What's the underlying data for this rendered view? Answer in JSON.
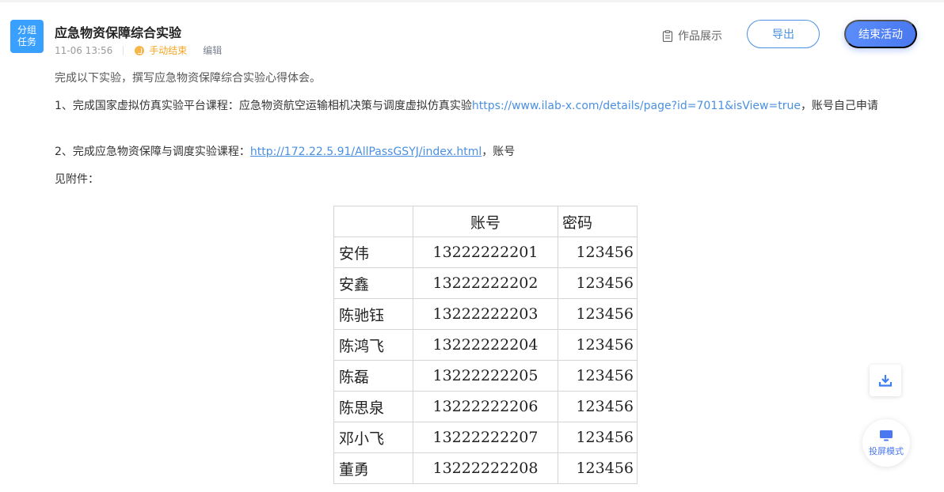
{
  "activity": {
    "badge_line1": "分组",
    "badge_line2": "任务",
    "title": "应急物资保障综合实验",
    "time": "11-06 13:56",
    "status": "手动结束",
    "edit": "编辑"
  },
  "toolbar": {
    "works_label": "作品展示",
    "export_label": "导出",
    "end_label": "结束活动"
  },
  "description": {
    "intro": "完成以下实验，撰写应急物资保障综合实验心得体会。",
    "item1_text": "1、完成国家虚拟仿真实验平台课程：应急物资航空运输相机决策与调度虚拟仿真实验",
    "item1_link": "https://www.ilab-x.com/details/page?id=7011&isView=true",
    "item1_suffix": "，账号自己申请",
    "item2_text": "2、完成应急物资保障与调度实验课程：",
    "item2_link": "http://172.22.5.91/AllPassGSYJ/index.html",
    "item2_suffix": "，账号",
    "attachment_label": "见附件："
  },
  "accounts": {
    "headers": [
      "",
      "账号",
      "密码"
    ],
    "rows": [
      [
        "安伟",
        "13222222201",
        "123456"
      ],
      [
        "安鑫",
        "13222222202",
        "123456"
      ],
      [
        "陈驰钰",
        "13222222203",
        "123456"
      ],
      [
        "陈鸿飞",
        "13222222204",
        "123456"
      ],
      [
        "陈磊",
        "13222222205",
        "123456"
      ],
      [
        "陈思泉",
        "13222222206",
        "123456"
      ],
      [
        "邓小飞",
        "13222222207",
        "123456"
      ],
      [
        "董勇",
        "13222222208",
        "123456"
      ]
    ]
  },
  "floating": {
    "cast_label": "投屏模式"
  },
  "colors": {
    "accent": "#4a90e2",
    "badge": "#3aa0ff",
    "status": "#f5a623"
  }
}
